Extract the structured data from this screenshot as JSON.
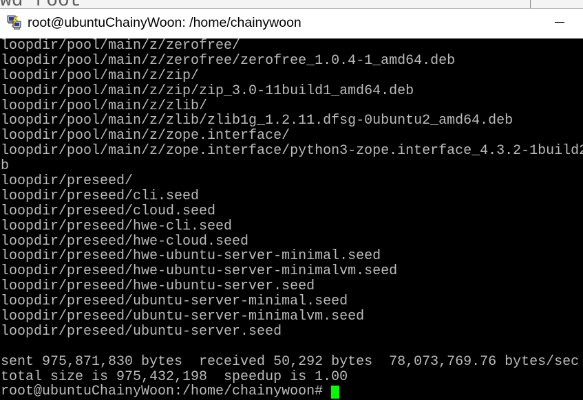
{
  "background_window": {
    "text": "wd root"
  },
  "window": {
    "title": "root@ubuntuChainyWoon: /home/chainywoon",
    "app_icon": "putty-icon",
    "controls": [
      "minimize-icon"
    ]
  },
  "terminal": {
    "colors": {
      "background": "#000000",
      "foreground": "#bbbbbb",
      "cursor": "#00ff00"
    },
    "lines": [
      "loopdir/pool/main/z/zerofree/",
      "loopdir/pool/main/z/zerofree/zerofree_1.0.4-1_amd64.deb",
      "loopdir/pool/main/z/zip/",
      "loopdir/pool/main/z/zip/zip_3.0-11build1_amd64.deb",
      "loopdir/pool/main/z/zlib/",
      "loopdir/pool/main/z/zlib/zlib1g_1.2.11.dfsg-0ubuntu2_amd64.deb",
      "loopdir/pool/main/z/zope.interface/",
      "loopdir/pool/main/z/zope.interface/python3-zope.interface_4.3.2-1build2",
      "b",
      "loopdir/preseed/",
      "loopdir/preseed/cli.seed",
      "loopdir/preseed/cloud.seed",
      "loopdir/preseed/hwe-cli.seed",
      "loopdir/preseed/hwe-cloud.seed",
      "loopdir/preseed/hwe-ubuntu-server-minimal.seed",
      "loopdir/preseed/hwe-ubuntu-server-minimalvm.seed",
      "loopdir/preseed/hwe-ubuntu-server.seed",
      "loopdir/preseed/ubuntu-server-minimal.seed",
      "loopdir/preseed/ubuntu-server-minimalvm.seed",
      "loopdir/preseed/ubuntu-server.seed",
      "",
      "sent 975,871,830 bytes  received 50,292 bytes  78,073,769.76 bytes/sec",
      "total size is 975,432,198  speedup is 1.00"
    ],
    "prompt": "root@ubuntuChainyWoon:/home/chainywoon# "
  }
}
